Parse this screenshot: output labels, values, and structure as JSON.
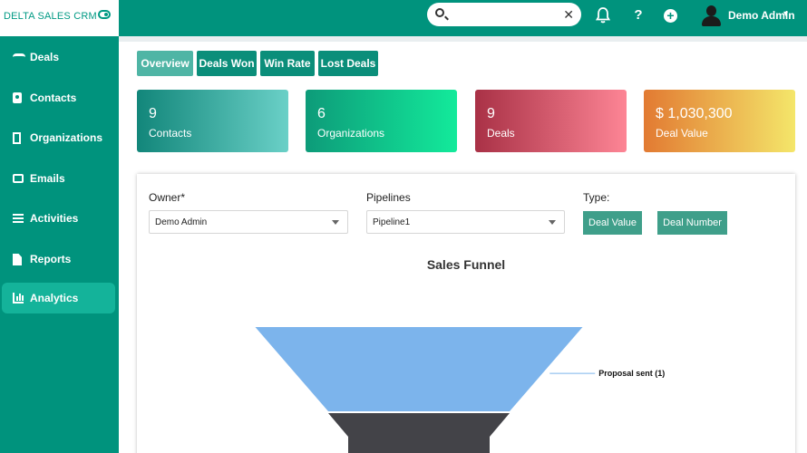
{
  "app": {
    "brand": "DELTA SALES CRM"
  },
  "header": {
    "search_value": "",
    "user_name": "Demo Admin"
  },
  "sidebar": {
    "items": [
      {
        "label": "Deals",
        "icon": "handshake-icon"
      },
      {
        "label": "Contacts",
        "icon": "contacts-icon"
      },
      {
        "label": "Organizations",
        "icon": "building-icon"
      },
      {
        "label": "Emails",
        "icon": "envelope-icon"
      },
      {
        "label": "Activities",
        "icon": "list-icon"
      },
      {
        "label": "Reports",
        "icon": "file-icon"
      },
      {
        "label": "Analytics",
        "icon": "bar-chart-icon",
        "active": true
      }
    ]
  },
  "tabs": [
    {
      "label": "Overview",
      "active": true
    },
    {
      "label": "Deals Won"
    },
    {
      "label": "Win Rate"
    },
    {
      "label": "Lost Deals"
    }
  ],
  "cards": [
    {
      "value": "9",
      "label": "Contacts"
    },
    {
      "value": "6",
      "label": "Organizations"
    },
    {
      "value": "9",
      "label": "Deals"
    },
    {
      "value": "$ 1,030,300",
      "label": "Deal Value"
    }
  ],
  "filters": {
    "owner_label": "Owner*",
    "owner_value": "Demo Admin",
    "pipelines_label": "Pipelines",
    "pipelines_value": "Pipeline1",
    "type_label": "Type:",
    "type_buttons": [
      "Deal Value",
      "Deal Number"
    ]
  },
  "chart_data": {
    "type": "funnel",
    "title": "Sales Funnel",
    "stages": [
      {
        "label": "Proposal sent (1)",
        "count": 1,
        "color": "#7cb4ec"
      },
      {
        "label": "",
        "count": null,
        "color": "#434348"
      }
    ]
  }
}
